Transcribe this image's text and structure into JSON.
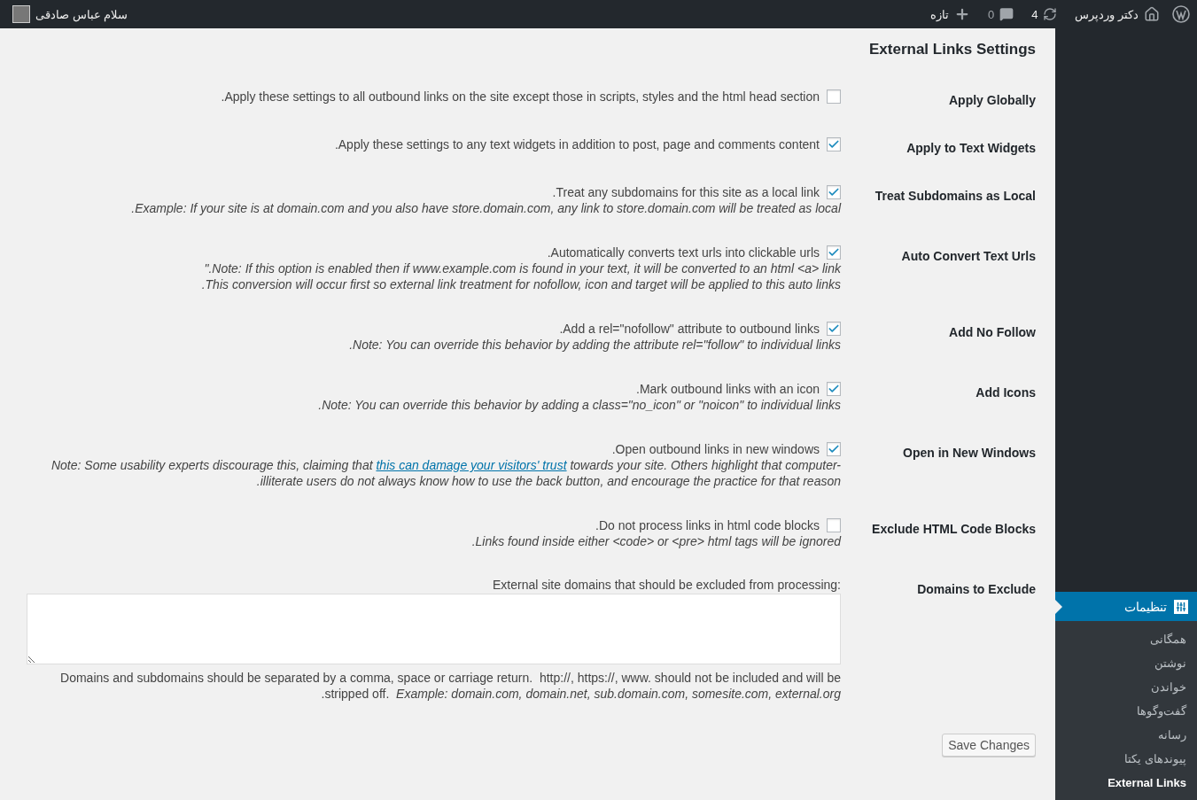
{
  "admin_bar": {
    "site_name": "دکتر وردپرس",
    "updates": "4",
    "comments": "0",
    "new_label": "تازه",
    "greeting": "سلام عباس صادقی"
  },
  "page_title": "External Links Settings",
  "settings": [
    {
      "kind": "checkbox",
      "label": "Apply Globally",
      "checked": false,
      "text": ".Apply these settings to all outbound links on the site except those in scripts, styles and the html head section"
    },
    {
      "kind": "checkbox",
      "label": "Apply to Text Widgets",
      "checked": true,
      "text": ".Apply these settings to any text widgets in addition to post, page and comments content"
    },
    {
      "kind": "checkbox",
      "label": "Treat Subdomains as Local",
      "checked": true,
      "text": ".Treat any subdomains for this site as a local link",
      "notes": [
        {
          "text": ".Example: If your site is at domain.com and you also have store.domain.com, any link to store.domain.com will be treated as local"
        }
      ]
    },
    {
      "kind": "checkbox",
      "label": "Auto Convert Text Urls",
      "checked": true,
      "text": ".Automatically converts text urls into clickable urls",
      "notes": [
        {
          "text": "\".Note: If this option is enabled then if www.example.com is found in your text, it will be converted to an html <a> link"
        },
        {
          "text": ".This conversion will occur first so external link treatment for nofollow, icon and target will be applied to this auto links"
        }
      ]
    },
    {
      "kind": "checkbox",
      "label": "Add No Follow",
      "checked": true,
      "text": ".Add a rel=\"nofollow\" attribute to outbound links",
      "notes": [
        {
          "text": ".Note: You can override this behavior by adding the attribute rel=\"follow\" to individual links"
        }
      ]
    },
    {
      "kind": "checkbox",
      "label": "Add Icons",
      "checked": true,
      "text": ".Mark outbound links with an icon",
      "notes": [
        {
          "text": ".Note: You can override this behavior by adding a class=\"no_icon\" or \"noicon\" to individual links"
        }
      ]
    },
    {
      "kind": "checkbox",
      "label": "Open in New Windows",
      "checked": true,
      "text": ".Open outbound links in new windows",
      "notes": [
        {
          "text": "Note: Some usability experts discourage this, claiming that",
          "link": "this can damage your visitors' trust",
          "after": "towards your site. Others highlight that computer-"
        },
        {
          "text": ".illiterate users do not always know how to use the back button, and encourage the practice for that reason"
        }
      ]
    },
    {
      "kind": "checkbox",
      "label": "Exclude HTML Code Blocks",
      "checked": false,
      "text": ".Do not process links in html code blocks",
      "notes": [
        {
          "text": ".Links found inside either <code> or <pre> html tags will be ignored"
        }
      ]
    },
    {
      "kind": "textarea",
      "label": "Domains to Exclude",
      "text": "External site domains that should be excluded from processing:",
      "notes": [
        {
          "text": "Domains and subdomains should be separated by a comma, space or carriage return.  http://, https://, www. should not be included and will be"
        },
        {
          "text": ".stripped off.  *Example: domain.com, domain.net, sub.domain.com, somesite.com, external.org*"
        }
      ]
    }
  ],
  "save_button": "Save Changes",
  "sidebar": {
    "menu": {
      "label": "تنظیمات",
      "selected": true
    },
    "submenu": [
      {
        "label": "همگانی",
        "selected": false
      },
      {
        "label": "نوشتن",
        "selected": false
      },
      {
        "label": "خواندن",
        "selected": false
      },
      {
        "label": "گفت‌وگوها",
        "selected": false
      },
      {
        "label": "رسانه",
        "selected": false
      },
      {
        "label": "پیوندهای یکتا",
        "selected": false
      },
      {
        "label": "External Links",
        "selected": true
      }
    ]
  }
}
